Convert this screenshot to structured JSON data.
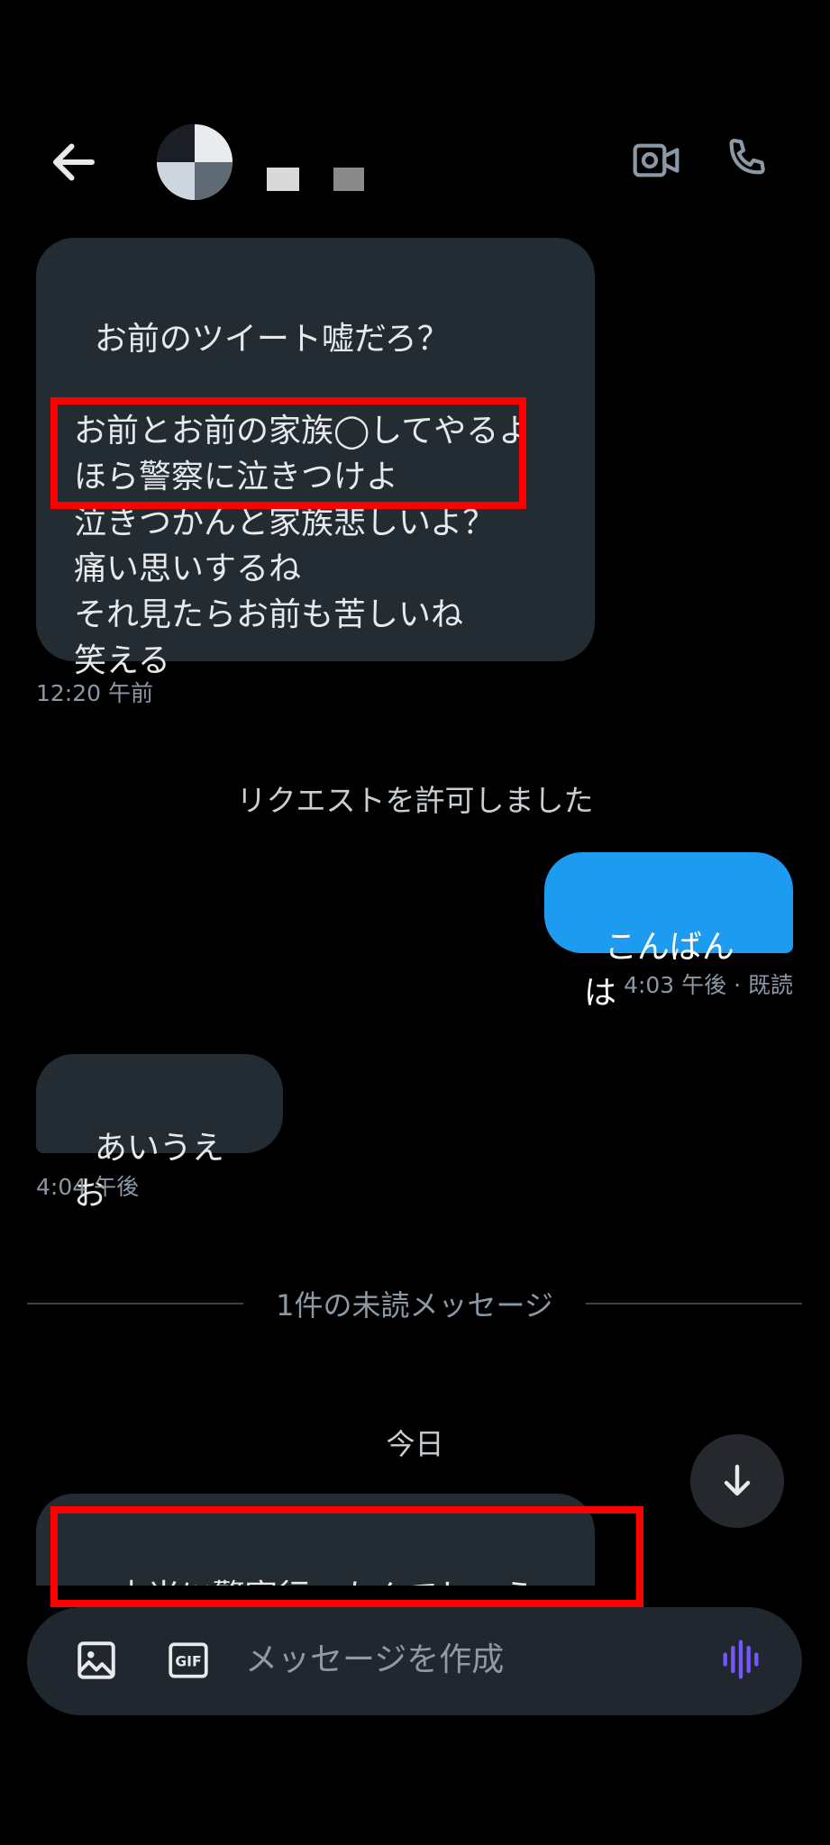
{
  "header": {
    "back_icon": "arrow-left-icon",
    "video_icon": "video-camera-icon",
    "phone_icon": "phone-icon"
  },
  "messages": [
    {
      "direction": "incoming",
      "text": "お前のツイート嘘だろ？\n\nお前とお前の家族◯してやるよ\nほら警察に泣きつけよ\n泣きつかんと家族悲しいよ？\n痛い思いするね\nそれ見たらお前も苦しいね\n笑える",
      "time": "12:20 午前"
    },
    {
      "system": "リクエストを許可しました"
    },
    {
      "direction": "outgoing",
      "text": "こんばんは",
      "time": "4:03 午後 · 既読"
    },
    {
      "direction": "incoming",
      "text": "あいうえお",
      "time": "4:04 午後"
    },
    {
      "unread_divider": "1件の未読メッセージ"
    },
    {
      "date_label": "今日"
    },
    {
      "direction": "incoming",
      "text": "本当に警察行ったんでしょう"
    }
  ],
  "composer": {
    "placeholder": "メッセージを作成",
    "image_icon": "image-icon",
    "gif_icon": "gif-icon",
    "voice_icon": "voice-wave-icon"
  },
  "colors": {
    "background": "#000000",
    "incoming_bubble": "#232b33",
    "outgoing_bubble": "#1d9bf0",
    "highlight": "#ff0000",
    "voice_accent": "#7856ff"
  }
}
